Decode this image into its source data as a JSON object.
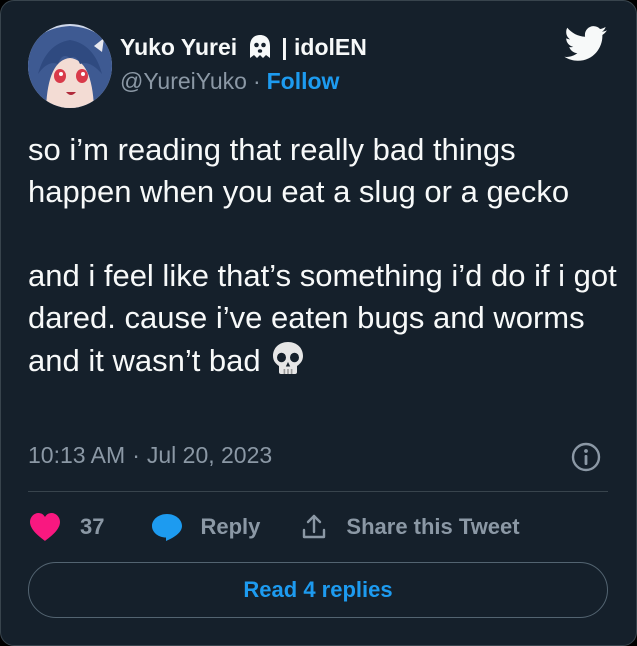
{
  "author": {
    "display_name": "Yuko Yurei",
    "name_suffix": "| idolEN",
    "name_emoji": "ghost-icon",
    "handle": "@YureiYuko",
    "separator": "·",
    "follow_label": "Follow"
  },
  "tweet": {
    "paragraph_1": "so i’m reading that really bad things happen when you eat a slug or a gecko",
    "paragraph_2": "and i feel like that’s something i’d do if i got dared. cause i’ve eaten bugs and worms and it wasn’t bad",
    "trailing_emoji": "skull-icon",
    "time": "10:13 AM",
    "separator": "·",
    "date": "Jul 20, 2023"
  },
  "actions": {
    "like_count": "37",
    "reply_label": "Reply",
    "share_label": "Share this Tweet",
    "read_replies_label": "Read 4 replies"
  },
  "colors": {
    "background": "#15202b",
    "text": "#f7f9f9",
    "muted": "#8b98a5",
    "accent": "#1d9bf0",
    "like": "#f91880",
    "border": "#38444d"
  },
  "icons": [
    "twitter-bird-icon",
    "ghost-icon",
    "skull-icon",
    "info-icon",
    "heart-icon",
    "reply-bubble-icon",
    "share-icon"
  ]
}
